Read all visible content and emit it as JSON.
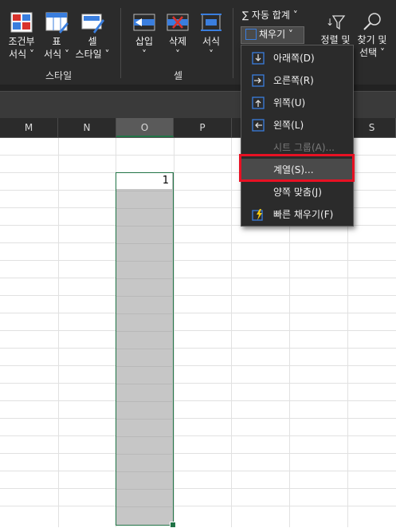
{
  "ribbon": {
    "conditional_format": {
      "line1": "조건부",
      "line2": "서식 ˅"
    },
    "format_table": {
      "line1": "표",
      "line2": "서식 ˅"
    },
    "cell_styles": {
      "line1": "셀",
      "line2": "스타일 ˅"
    },
    "insert": {
      "line1": "삽입",
      "line2": "˅"
    },
    "delete": {
      "line1": "삭제",
      "line2": "˅"
    },
    "format": {
      "line1": "서식",
      "line2": "˅"
    },
    "autosum": "∑ 자동 합계 ˅",
    "fill": "채우기 ˅",
    "sort_filter": {
      "line1": "정렬 및",
      "line2": ""
    },
    "find_select": {
      "line1": "찾기 및",
      "line2": "선택 ˅"
    },
    "group_styles": "스타일",
    "group_cells": "셀"
  },
  "columns": [
    "M",
    "N",
    "O",
    "P",
    "",
    "S"
  ],
  "selected_column": "O",
  "cell_value": "1",
  "fill_menu": {
    "items": [
      {
        "label": "아래쪽(D)",
        "icon": "fill-down-icon",
        "enabled": true
      },
      {
        "label": "오른쪽(R)",
        "icon": "fill-right-icon",
        "enabled": true
      },
      {
        "label": "위쪽(U)",
        "icon": "fill-up-icon",
        "enabled": true
      },
      {
        "label": "왼쪽(L)",
        "icon": "fill-left-icon",
        "enabled": true
      },
      {
        "label": "시트 그룹(A)...",
        "icon": "",
        "enabled": false
      },
      {
        "label": "계열(S)...",
        "icon": "",
        "enabled": true,
        "highlighted": true
      },
      {
        "label": "양쪽 맞춤(J)",
        "icon": "",
        "enabled": true
      },
      {
        "label": "빠른 채우기(F)",
        "icon": "flash-fill-icon",
        "enabled": true
      }
    ]
  },
  "colors": {
    "ribbon_bg": "#2b2b2b",
    "accent": "#217346",
    "highlight_box": "#e81123"
  }
}
